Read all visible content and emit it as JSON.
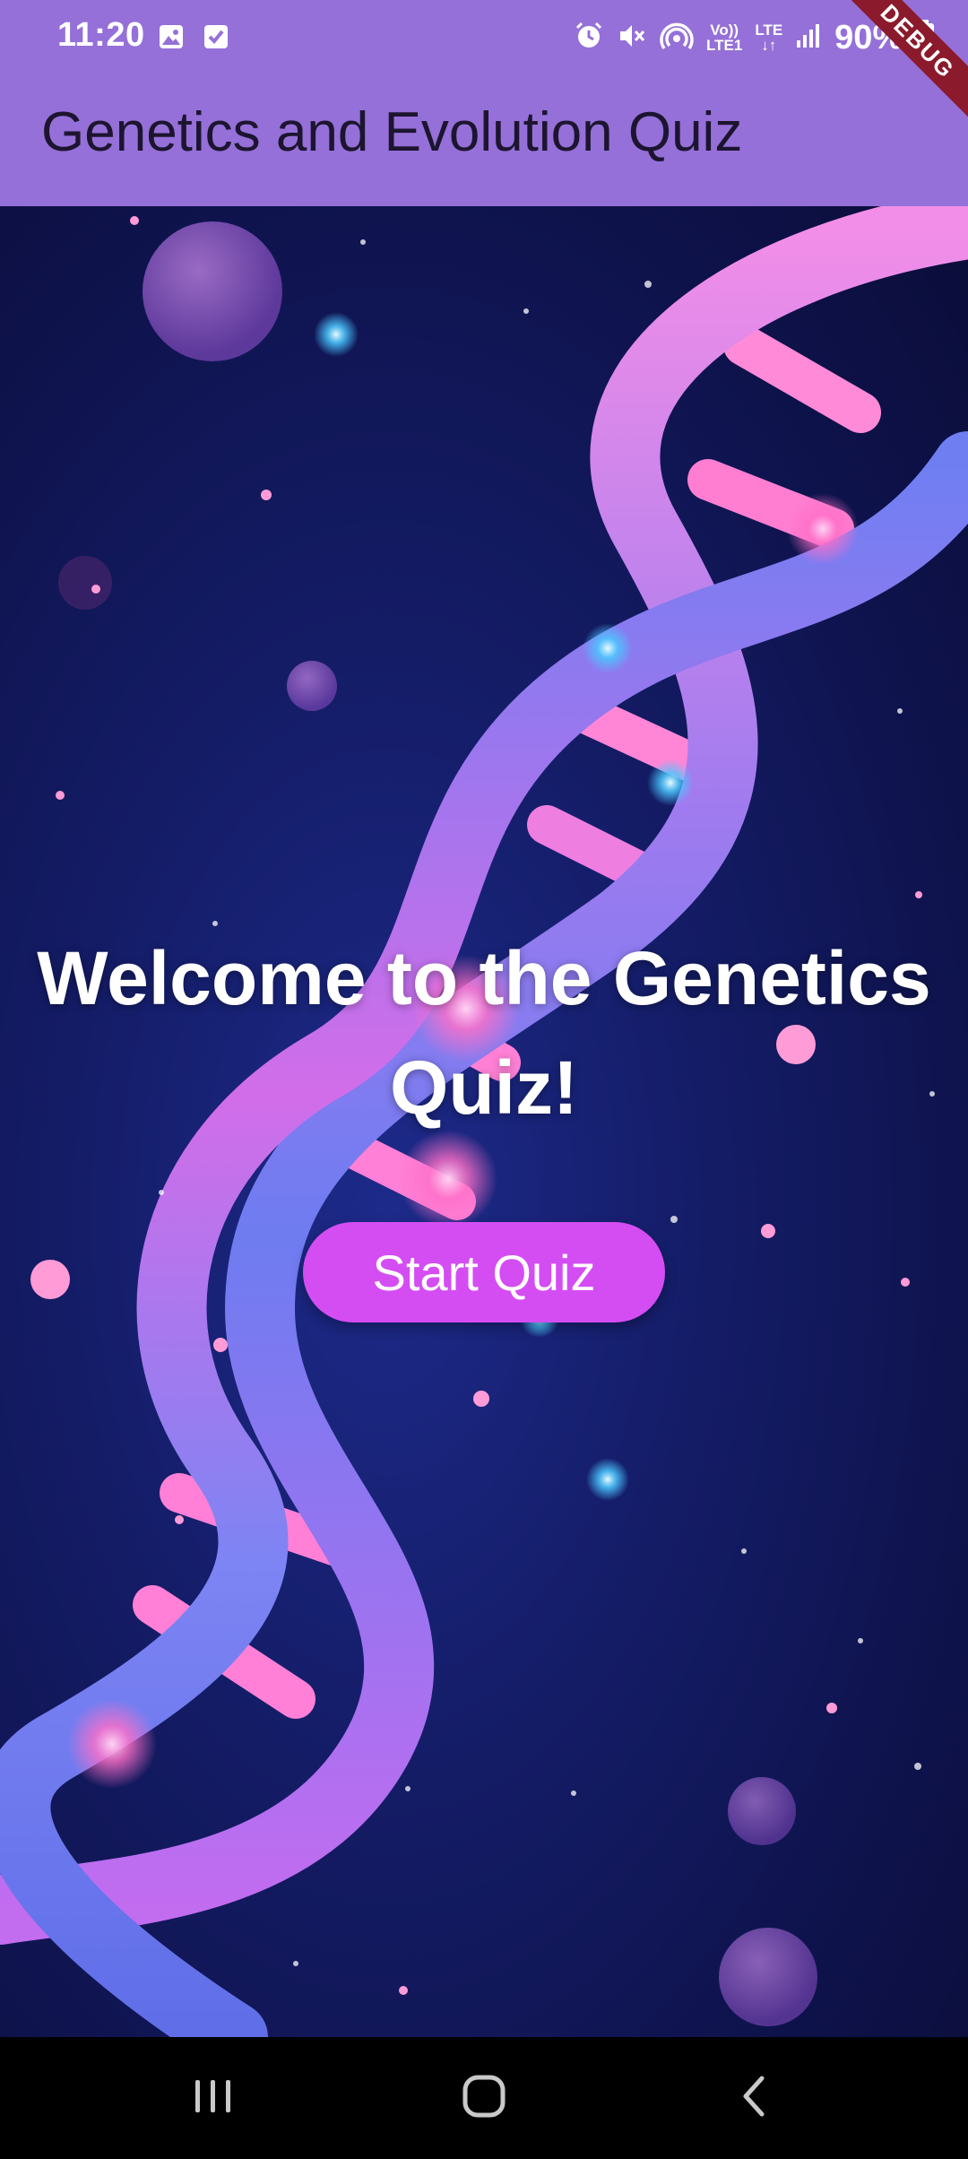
{
  "status_bar": {
    "time": "11:20",
    "left_icons": [
      "image-icon",
      "checkbox-icon"
    ],
    "right_icons": [
      "alarm-icon",
      "mute-icon",
      "hotspot-icon"
    ],
    "volte": "Vo))\nLTE1",
    "network": "LTE",
    "battery": "90%"
  },
  "app_bar": {
    "title": "Genetics and Evolution Quiz",
    "color": "#9570d8"
  },
  "debug_banner": "DEBUG",
  "main": {
    "welcome_text": "Welcome to the Genetics Quiz!",
    "start_button_label": "Start Quiz",
    "button_color": "#d44df2"
  },
  "nav_bar": {
    "buttons": [
      "recents-icon",
      "home-icon",
      "back-icon"
    ]
  }
}
